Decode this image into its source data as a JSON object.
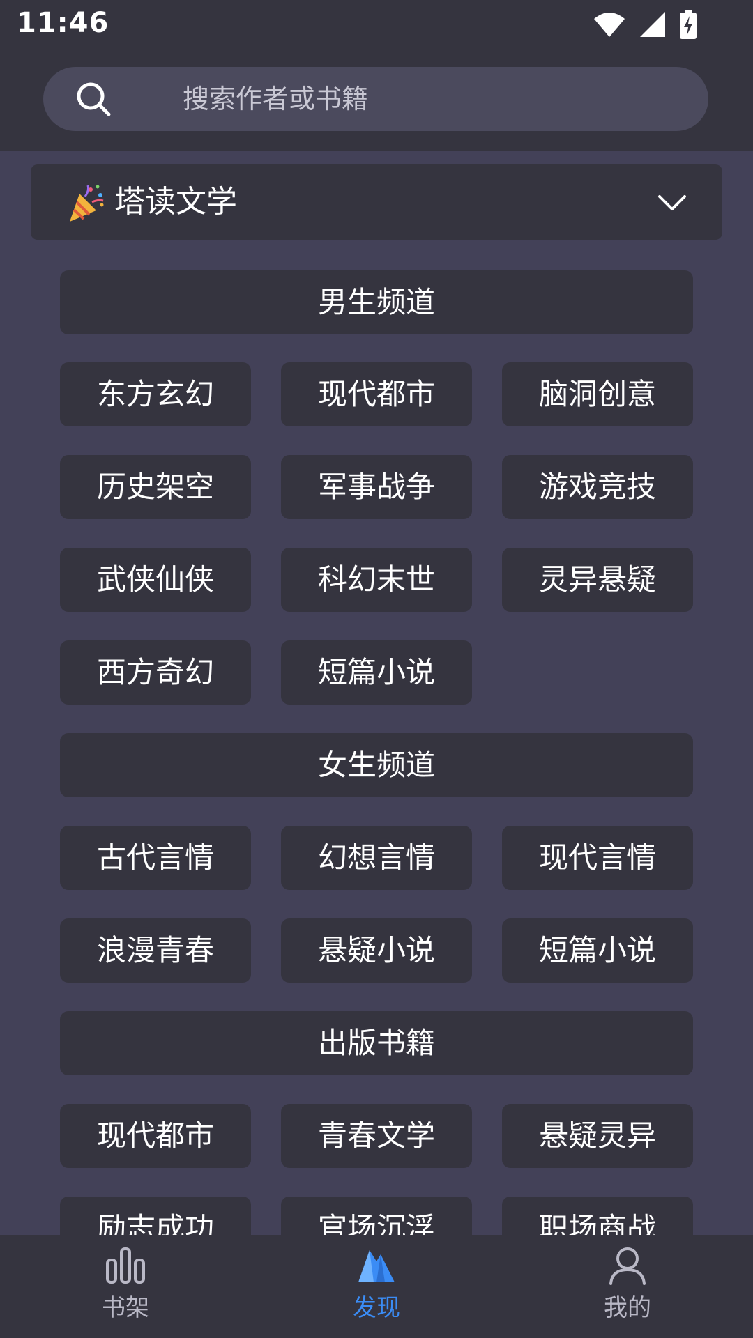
{
  "status_bar": {
    "time": "11:46"
  },
  "search": {
    "placeholder": "搜索作者或书籍"
  },
  "source_selector": {
    "label": "塔读文学"
  },
  "sections": [
    {
      "title": "男生频道",
      "items": [
        "东方玄幻",
        "现代都市",
        "脑洞创意",
        "历史架空",
        "军事战争",
        "游戏竞技",
        "武侠仙侠",
        "科幻末世",
        "灵异悬疑",
        "西方奇幻",
        "短篇小说"
      ]
    },
    {
      "title": "女生频道",
      "items": [
        "古代言情",
        "幻想言情",
        "现代言情",
        "浪漫青春",
        "悬疑小说",
        "短篇小说"
      ]
    },
    {
      "title": "出版书籍",
      "items": [
        "现代都市",
        "青春文学",
        "悬疑灵异",
        "励志成功",
        "官场沉浮",
        "职场商战"
      ]
    }
  ],
  "bottom_nav": {
    "items": [
      {
        "label": "书架",
        "icon": "bookshelf-icon",
        "active": false
      },
      {
        "label": "发现",
        "icon": "discover-icon",
        "active": true
      },
      {
        "label": "我的",
        "icon": "profile-icon",
        "active": false
      }
    ]
  },
  "colors": {
    "background": "#434158",
    "surface": "#35343f",
    "search_bg": "#4b4a5d",
    "accent": "#3b8cf5",
    "inactive": "#b9b8c6",
    "text": "#ffffff"
  }
}
